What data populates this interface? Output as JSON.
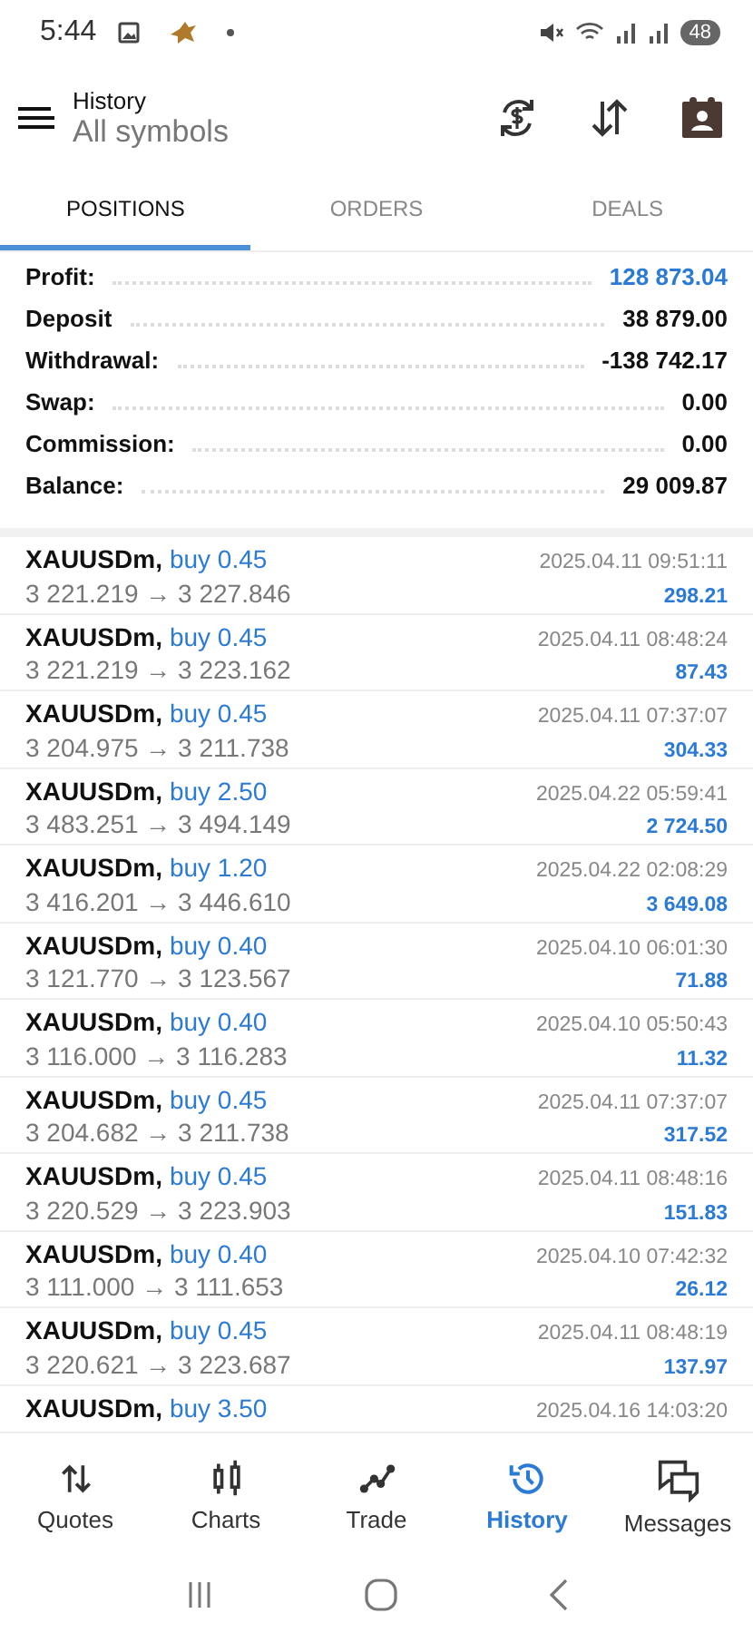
{
  "status_bar": {
    "time": "5:44",
    "battery": "48"
  },
  "header": {
    "title": "History",
    "subtitle": "All symbols"
  },
  "tabs": [
    {
      "label": "POSITIONS",
      "selected": true
    },
    {
      "label": "ORDERS",
      "selected": false
    },
    {
      "label": "DEALS",
      "selected": false
    }
  ],
  "summary": [
    {
      "label": "Profit:",
      "value": "128 873.04",
      "highlight": true
    },
    {
      "label": "Deposit",
      "value": "38 879.00",
      "highlight": false
    },
    {
      "label": "Withdrawal:",
      "value": "-138 742.17",
      "highlight": false
    },
    {
      "label": "Swap:",
      "value": "0.00",
      "highlight": false
    },
    {
      "label": "Commission:",
      "value": "0.00",
      "highlight": false
    },
    {
      "label": "Balance:",
      "value": "29 009.87",
      "highlight": false
    }
  ],
  "positions": [
    {
      "symbol": "XAUUSDm,",
      "side": "buy 0.45",
      "prices": "3 221.219 → 3 227.846",
      "time": "2025.04.11 09:51:11",
      "profit": "298.21"
    },
    {
      "symbol": "XAUUSDm,",
      "side": "buy 0.45",
      "prices": "3 221.219 → 3 223.162",
      "time": "2025.04.11 08:48:24",
      "profit": "87.43"
    },
    {
      "symbol": "XAUUSDm,",
      "side": "buy 0.45",
      "prices": "3 204.975 → 3 211.738",
      "time": "2025.04.11 07:37:07",
      "profit": "304.33"
    },
    {
      "symbol": "XAUUSDm,",
      "side": "buy 2.50",
      "prices": "3 483.251 → 3 494.149",
      "time": "2025.04.22 05:59:41",
      "profit": "2 724.50"
    },
    {
      "symbol": "XAUUSDm,",
      "side": "buy 1.20",
      "prices": "3 416.201 → 3 446.610",
      "time": "2025.04.22 02:08:29",
      "profit": "3 649.08"
    },
    {
      "symbol": "XAUUSDm,",
      "side": "buy 0.40",
      "prices": "3 121.770 → 3 123.567",
      "time": "2025.04.10 06:01:30",
      "profit": "71.88"
    },
    {
      "symbol": "XAUUSDm,",
      "side": "buy 0.40",
      "prices": "3 116.000 → 3 116.283",
      "time": "2025.04.10 05:50:43",
      "profit": "11.32"
    },
    {
      "symbol": "XAUUSDm,",
      "side": "buy 0.45",
      "prices": "3 204.682 → 3 211.738",
      "time": "2025.04.11 07:37:07",
      "profit": "317.52"
    },
    {
      "symbol": "XAUUSDm,",
      "side": "buy 0.45",
      "prices": "3 220.529 → 3 223.903",
      "time": "2025.04.11 08:48:16",
      "profit": "151.83"
    },
    {
      "symbol": "XAUUSDm,",
      "side": "buy 0.40",
      "prices": "3 111.000 → 3 111.653",
      "time": "2025.04.10 07:42:32",
      "profit": "26.12"
    },
    {
      "symbol": "XAUUSDm,",
      "side": "buy 0.45",
      "prices": "3 220.621 → 3 223.687",
      "time": "2025.04.11 08:48:19",
      "profit": "137.97"
    },
    {
      "symbol": "XAUUSDm,",
      "side": "buy 3.50",
      "time": "2025.04.16 14:03:20"
    }
  ],
  "bottom_nav": [
    {
      "label": "Quotes",
      "kind": "quotes",
      "selected": false
    },
    {
      "label": "Charts",
      "kind": "charts",
      "selected": false
    },
    {
      "label": "Trade",
      "kind": "trade",
      "selected": false
    },
    {
      "label": "History",
      "kind": "history",
      "selected": true
    },
    {
      "label": "Messages",
      "kind": "messages",
      "selected": false
    }
  ]
}
